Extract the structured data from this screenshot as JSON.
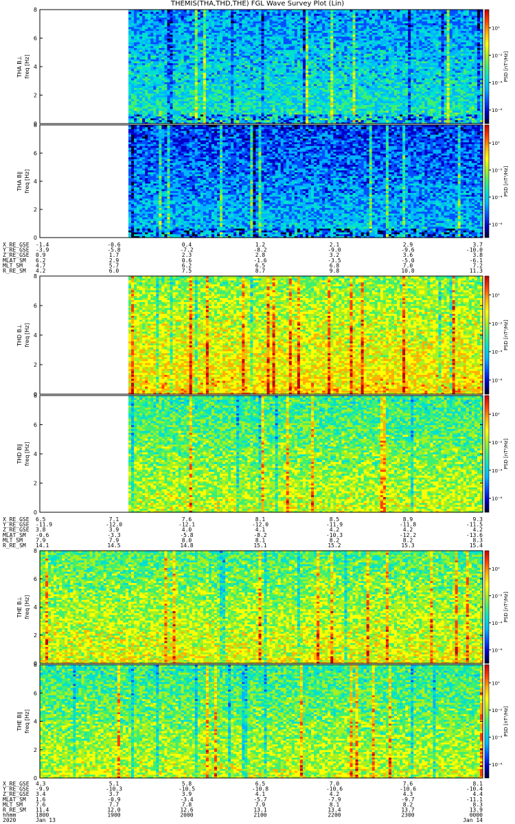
{
  "title": "THEMIS(THA,THD,THE) FGL Wave Survey Plot (Lin)",
  "chart_data": [
    {
      "type": "heatmap",
      "name": "THA B⊥",
      "ylabel": "THA B⊥\nfreq [Hz]",
      "ylim": [
        0,
        8
      ],
      "yticks": [
        0,
        2,
        4,
        6,
        8
      ],
      "colorbar_label": "PSD [nT²/Hz]",
      "colorbar_ticks": [
        "10⁰",
        "10⁻²",
        "10⁻⁴",
        "10⁻⁶"
      ],
      "data_start_fraction": 0.2,
      "level": "low",
      "events": []
    },
    {
      "type": "heatmap",
      "name": "THA B∥",
      "ylabel": "THA B∥\nfreq [Hz]",
      "ylim": [
        0,
        8
      ],
      "yticks": [
        0,
        2,
        4,
        6,
        8
      ],
      "colorbar_label": "PSD [nT²/Hz]",
      "colorbar_ticks": [
        "10⁰",
        "10⁻²",
        "10⁻⁴",
        "10⁻⁶"
      ],
      "data_start_fraction": 0.2,
      "level": "verylow",
      "events": []
    },
    {
      "type": "heatmap",
      "name": "THD B⊥",
      "ylabel": "THD B⊥\nfreq [Hz]",
      "ylim": [
        0,
        8
      ],
      "yticks": [
        0,
        2,
        4,
        6,
        8
      ],
      "colorbar_label": "PSD [nT²/Hz]",
      "colorbar_ticks": [
        "10⁰",
        "10⁻²",
        "10⁻⁴",
        "10⁻⁶"
      ],
      "data_start_fraction": 0.2,
      "level": "high",
      "events": []
    },
    {
      "type": "heatmap",
      "name": "THD B∥",
      "ylabel": "THD B∥\nfreq [Hz]",
      "ylim": [
        0,
        8
      ],
      "yticks": [
        0,
        2,
        4,
        6,
        8
      ],
      "colorbar_label": "PSD [nT²/Hz]",
      "colorbar_ticks": [
        "10⁰",
        "10⁻²",
        "10⁻⁴",
        "10⁻⁶"
      ],
      "data_start_fraction": 0.2,
      "level": "mid",
      "events": []
    },
    {
      "type": "heatmap",
      "name": "THE B⊥",
      "ylabel": "THE B⊥\nfreq [Hz]",
      "ylim": [
        0,
        8
      ],
      "yticks": [
        0,
        2,
        4,
        6,
        8
      ],
      "colorbar_label": "PSD [nT²/Hz]",
      "colorbar_ticks": [
        "10⁰",
        "10⁻²",
        "10⁻⁴",
        "10⁻⁶"
      ],
      "data_start_fraction": 0.0,
      "level": "midhigh",
      "events": []
    },
    {
      "type": "heatmap",
      "name": "THE B∥",
      "ylabel": "THE B∥\nfreq [Hz]",
      "ylim": [
        0,
        8
      ],
      "yticks": [
        0,
        2,
        4,
        6,
        8
      ],
      "colorbar_label": "PSD [nT²/Hz]",
      "colorbar_ticks": [
        "10⁰",
        "10⁻²",
        "10⁻⁴",
        "10⁻⁶"
      ],
      "data_start_fraction": 0.0,
      "level": "mid",
      "events": []
    }
  ],
  "ephemeris": [
    {
      "rows": [
        {
          "label": "X_RE_GSE",
          "values": [
            "-1.4",
            "-0.6",
            "0.4",
            "1.2",
            "2.1",
            "2.9",
            "3.7"
          ]
        },
        {
          "label": "Y_RE_GSE",
          "values": [
            "-3.9",
            "-5.8",
            "-7.2",
            "-8.2",
            "-9.0",
            "-9.6",
            "-10.0"
          ]
        },
        {
          "label": "Z_RE_GSE",
          "values": [
            "0.9",
            "1.7",
            "2.3",
            "2.8",
            "3.2",
            "3.6",
            "3.8"
          ]
        },
        {
          "label": "MLAT_SM",
          "values": [
            "6.2",
            "2.9",
            "0.6",
            "-1.6",
            "-3.5",
            "-5.0",
            "-6.1"
          ]
        },
        {
          "label": "MLT_SM",
          "values": [
            "4.7",
            "5.7",
            "6.2",
            "6.5",
            "6.8",
            "7.0",
            "7.2"
          ]
        },
        {
          "label": "R_RE_SM",
          "values": [
            "4.2",
            "6.0",
            "7.5",
            "8.7",
            "9.8",
            "10.8",
            "11.3"
          ]
        }
      ]
    },
    {
      "rows": [
        {
          "label": "X_RE_GSE",
          "values": [
            "6.5",
            "7.1",
            "7.6",
            "8.1",
            "8.5",
            "8.9",
            "9.3"
          ]
        },
        {
          "label": "Y_RE_GSE",
          "values": [
            "-11.9",
            "-12.0",
            "-12.1",
            "-12.0",
            "-11.9",
            "-11.8",
            "-11.5"
          ]
        },
        {
          "label": "Z_RE_GSE",
          "values": [
            "3.8",
            "3.9",
            "4.0",
            "4.1",
            "4.2",
            "4.2",
            "4.2"
          ]
        },
        {
          "label": "MLAT_SM",
          "values": [
            "-0.6",
            "-3.3",
            "-5.8",
            "-8.2",
            "-10.3",
            "-12.2",
            "-13.6"
          ]
        },
        {
          "label": "MLT_SM",
          "values": [
            "7.9",
            "7.9",
            "8.0",
            "8.1",
            "8.2",
            "8.2",
            "8.3"
          ]
        },
        {
          "label": "R_RE_SM",
          "values": [
            "14.1",
            "14.5",
            "14.8",
            "15.1",
            "15.2",
            "15.3",
            "15.4"
          ]
        }
      ]
    },
    {
      "rows": [
        {
          "label": "X_RE_GSE",
          "values": [
            "4.3",
            "5.1",
            "5.8",
            "6.5",
            "7.0",
            "7.6",
            "8.1"
          ]
        },
        {
          "label": "Y_RE_GSE",
          "values": [
            "-9.9",
            "-10.3",
            "-10.5",
            "-10.8",
            "-10.6",
            "-10.6",
            "-10.4"
          ]
        },
        {
          "label": "Z_RE_GSE",
          "values": [
            "3.4",
            "3.7",
            "3.9",
            "4.1",
            "4.2",
            "4.3",
            "4.4"
          ]
        },
        {
          "label": "MLAT_SM",
          "values": [
            "1.6",
            "-0.9",
            "-3.4",
            "-5.7",
            "-7.9",
            "-9.7",
            "-11.1"
          ]
        },
        {
          "label": "MLT_SM",
          "values": [
            "7.6",
            "7.7",
            "7.8",
            "7.9",
            "8.1",
            "8.2",
            "8.3"
          ]
        },
        {
          "label": "R_RE_SM",
          "values": [
            "11.4",
            "12.0",
            "12.6",
            "13.1",
            "13.4",
            "13.7",
            "13.9"
          ]
        },
        {
          "label": "hhmm",
          "values": [
            "1800",
            "1900",
            "2000",
            "2100",
            "2200",
            "2300",
            "0000"
          ]
        },
        {
          "label": "2020",
          "values": [
            "Jan 13",
            "",
            "",
            "",
            "",
            "",
            "Jan 14"
          ]
        }
      ]
    }
  ],
  "colors": {
    "colormap": [
      "#00002a",
      "#0000c8",
      "#0050ff",
      "#00b4ff",
      "#00e0d0",
      "#3ff070",
      "#a8f020",
      "#ffff00",
      "#ffb000",
      "#ff4000",
      "#c80000"
    ]
  }
}
